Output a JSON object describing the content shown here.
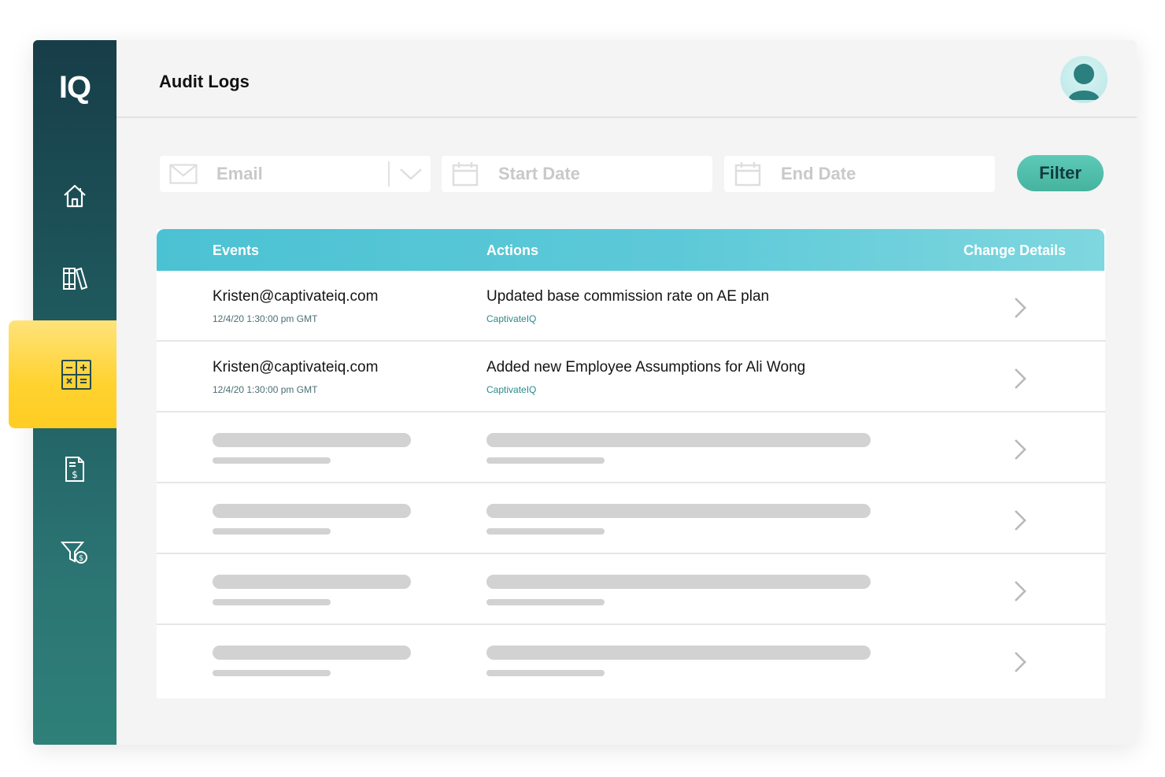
{
  "app": {
    "logo_text": "IQ"
  },
  "sidebar": {
    "items": [
      {
        "name": "home",
        "icon": "home-icon"
      },
      {
        "name": "library",
        "icon": "library-icon"
      },
      {
        "name": "calculator",
        "icon": "calculator-icon",
        "active": true
      },
      {
        "name": "payout-document",
        "icon": "dollar-document-icon"
      },
      {
        "name": "filter-payouts",
        "icon": "dollar-filter-icon"
      }
    ]
  },
  "header": {
    "title": "Audit Logs",
    "avatar_icon": "user-icon"
  },
  "filters": {
    "email_placeholder": "Email",
    "start_date_placeholder": "Start Date",
    "end_date_placeholder": "End Date",
    "filter_label": "Filter"
  },
  "table": {
    "columns": [
      "Events",
      "Actions",
      "Change Details"
    ],
    "rows": [
      {
        "event": "Kristen@captivateiq.com",
        "timestamp": "12/4/20 1:30:00 pm GMT",
        "action": "Updated base commission rate on AE plan",
        "source": "CaptivateIQ"
      },
      {
        "event": "Kristen@captivateiq.com",
        "timestamp": "12/4/20 1:30:00 pm GMT",
        "action": "Added new Employee Assumptions for Ali Wong",
        "source": "CaptivateIQ"
      }
    ],
    "placeholder_rows": 4
  },
  "colors": {
    "sidebar_dark": "#173d48",
    "sidebar_light": "#2f8079",
    "active_yellow": "#ffd22e",
    "header_teal": "#4bc2d3",
    "filter_green": "#4fbfaa",
    "source_teal": "#2a8a8a"
  }
}
